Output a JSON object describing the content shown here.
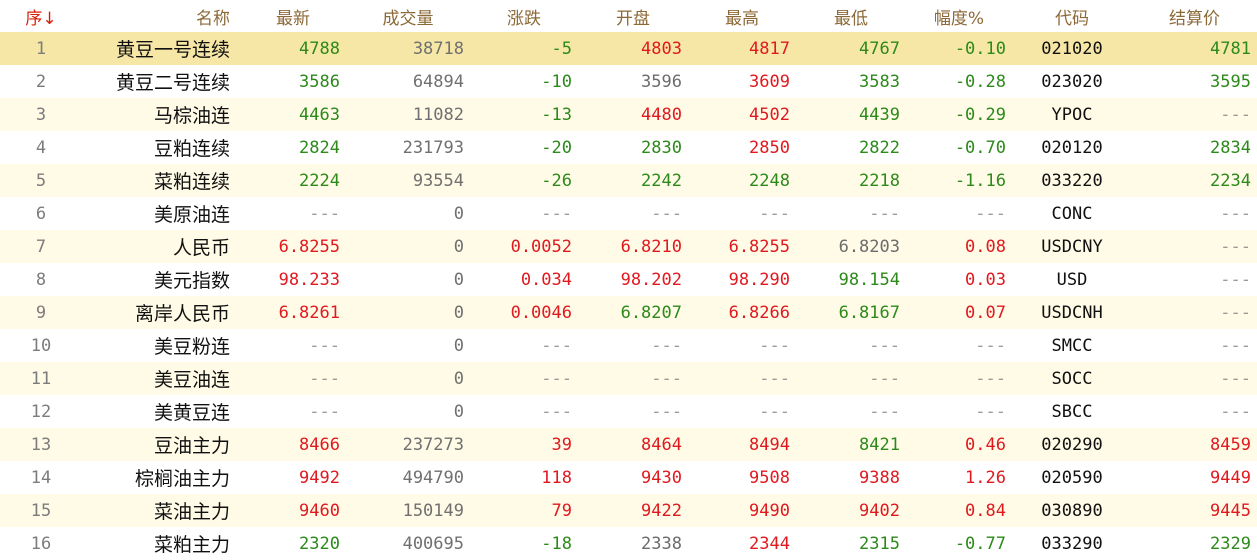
{
  "columns": [
    "序",
    "名称",
    "最新",
    "成交量",
    "涨跌",
    "开盘",
    "最高",
    "最低",
    "幅度%",
    "代码",
    "结算价"
  ],
  "sort_indicator": "↓",
  "colors": {
    "up": "#e0191f",
    "down": "#2c8a1a",
    "flat": "#6c6c6c",
    "header": "#8c6a38",
    "selected_row": "#f6e7a6"
  },
  "rows": [
    {
      "seq": "1",
      "name": "黄豆一号连续",
      "last": "4788",
      "last_c": "down",
      "volume": "38718",
      "change": "-5",
      "change_c": "down",
      "open": "4803",
      "open_c": "up",
      "high": "4817",
      "high_c": "up",
      "low": "4767",
      "low_c": "down",
      "pct": "-0.10",
      "pct_c": "down",
      "code": "021020",
      "settle": "4781",
      "settle_c": "down"
    },
    {
      "seq": "2",
      "name": "黄豆二号连续",
      "last": "3586",
      "last_c": "down",
      "volume": "64894",
      "change": "-10",
      "change_c": "down",
      "open": "3596",
      "open_c": "flat",
      "high": "3609",
      "high_c": "up",
      "low": "3583",
      "low_c": "down",
      "pct": "-0.28",
      "pct_c": "down",
      "code": "023020",
      "settle": "3595",
      "settle_c": "down"
    },
    {
      "seq": "3",
      "name": "马棕油连",
      "last": "4463",
      "last_c": "down",
      "volume": "11082",
      "change": "-13",
      "change_c": "down",
      "open": "4480",
      "open_c": "up",
      "high": "4502",
      "high_c": "up",
      "low": "4439",
      "low_c": "down",
      "pct": "-0.29",
      "pct_c": "down",
      "code": "YPOC",
      "settle": "---",
      "settle_c": "dash"
    },
    {
      "seq": "4",
      "name": "豆粕连续",
      "last": "2824",
      "last_c": "down",
      "volume": "231793",
      "change": "-20",
      "change_c": "down",
      "open": "2830",
      "open_c": "down",
      "high": "2850",
      "high_c": "up",
      "low": "2822",
      "low_c": "down",
      "pct": "-0.70",
      "pct_c": "down",
      "code": "020120",
      "settle": "2834",
      "settle_c": "down"
    },
    {
      "seq": "5",
      "name": "菜粕连续",
      "last": "2224",
      "last_c": "down",
      "volume": "93554",
      "change": "-26",
      "change_c": "down",
      "open": "2242",
      "open_c": "down",
      "high": "2248",
      "high_c": "down",
      "low": "2218",
      "low_c": "down",
      "pct": "-1.16",
      "pct_c": "down",
      "code": "033220",
      "settle": "2234",
      "settle_c": "down"
    },
    {
      "seq": "6",
      "name": "美原油连",
      "last": "---",
      "last_c": "dash",
      "volume": "0",
      "change": "---",
      "change_c": "dash",
      "open": "---",
      "open_c": "dash",
      "high": "---",
      "high_c": "dash",
      "low": "---",
      "low_c": "dash",
      "pct": "---",
      "pct_c": "dash",
      "code": "CONC",
      "settle": "---",
      "settle_c": "dash"
    },
    {
      "seq": "7",
      "name": "人民币",
      "last": "6.8255",
      "last_c": "up",
      "volume": "0",
      "change": "0.0052",
      "change_c": "up",
      "open": "6.8210",
      "open_c": "up",
      "high": "6.8255",
      "high_c": "up",
      "low": "6.8203",
      "low_c": "flat",
      "pct": "0.08",
      "pct_c": "up",
      "code": "USDCNY",
      "settle": "---",
      "settle_c": "dash"
    },
    {
      "seq": "8",
      "name": "美元指数",
      "last": "98.233",
      "last_c": "up",
      "volume": "0",
      "change": "0.034",
      "change_c": "up",
      "open": "98.202",
      "open_c": "up",
      "high": "98.290",
      "high_c": "up",
      "low": "98.154",
      "low_c": "down",
      "pct": "0.03",
      "pct_c": "up",
      "code": "USD",
      "settle": "---",
      "settle_c": "dash"
    },
    {
      "seq": "9",
      "name": "离岸人民币",
      "last": "6.8261",
      "last_c": "up",
      "volume": "0",
      "change": "0.0046",
      "change_c": "up",
      "open": "6.8207",
      "open_c": "down",
      "high": "6.8266",
      "high_c": "up",
      "low": "6.8167",
      "low_c": "down",
      "pct": "0.07",
      "pct_c": "up",
      "code": "USDCNH",
      "settle": "---",
      "settle_c": "dash"
    },
    {
      "seq": "10",
      "name": "美豆粉连",
      "last": "---",
      "last_c": "dash",
      "volume": "0",
      "change": "---",
      "change_c": "dash",
      "open": "---",
      "open_c": "dash",
      "high": "---",
      "high_c": "dash",
      "low": "---",
      "low_c": "dash",
      "pct": "---",
      "pct_c": "dash",
      "code": "SMCC",
      "settle": "---",
      "settle_c": "dash"
    },
    {
      "seq": "11",
      "name": "美豆油连",
      "last": "---",
      "last_c": "dash",
      "volume": "0",
      "change": "---",
      "change_c": "dash",
      "open": "---",
      "open_c": "dash",
      "high": "---",
      "high_c": "dash",
      "low": "---",
      "low_c": "dash",
      "pct": "---",
      "pct_c": "dash",
      "code": "SOCC",
      "settle": "---",
      "settle_c": "dash"
    },
    {
      "seq": "12",
      "name": "美黄豆连",
      "last": "---",
      "last_c": "dash",
      "volume": "0",
      "change": "---",
      "change_c": "dash",
      "open": "---",
      "open_c": "dash",
      "high": "---",
      "high_c": "dash",
      "low": "---",
      "low_c": "dash",
      "pct": "---",
      "pct_c": "dash",
      "code": "SBCC",
      "settle": "---",
      "settle_c": "dash"
    },
    {
      "seq": "13",
      "name": "豆油主力",
      "last": "8466",
      "last_c": "up",
      "volume": "237273",
      "change": "39",
      "change_c": "up",
      "open": "8464",
      "open_c": "up",
      "high": "8494",
      "high_c": "up",
      "low": "8421",
      "low_c": "down",
      "pct": "0.46",
      "pct_c": "up",
      "code": "020290",
      "settle": "8459",
      "settle_c": "up"
    },
    {
      "seq": "14",
      "name": "棕榈油主力",
      "last": "9492",
      "last_c": "up",
      "volume": "494790",
      "change": "118",
      "change_c": "up",
      "open": "9430",
      "open_c": "up",
      "high": "9508",
      "high_c": "up",
      "low": "9388",
      "low_c": "up",
      "pct": "1.26",
      "pct_c": "up",
      "code": "020590",
      "settle": "9449",
      "settle_c": "up"
    },
    {
      "seq": "15",
      "name": "菜油主力",
      "last": "9460",
      "last_c": "up",
      "volume": "150149",
      "change": "79",
      "change_c": "up",
      "open": "9422",
      "open_c": "up",
      "high": "9490",
      "high_c": "up",
      "low": "9402",
      "low_c": "up",
      "pct": "0.84",
      "pct_c": "up",
      "code": "030890",
      "settle": "9445",
      "settle_c": "up"
    },
    {
      "seq": "16",
      "name": "菜粕主力",
      "last": "2320",
      "last_c": "down",
      "volume": "400695",
      "change": "-18",
      "change_c": "down",
      "open": "2338",
      "open_c": "flat",
      "high": "2344",
      "high_c": "up",
      "low": "2315",
      "low_c": "down",
      "pct": "-0.77",
      "pct_c": "down",
      "code": "033290",
      "settle": "2329",
      "settle_c": "down"
    }
  ]
}
